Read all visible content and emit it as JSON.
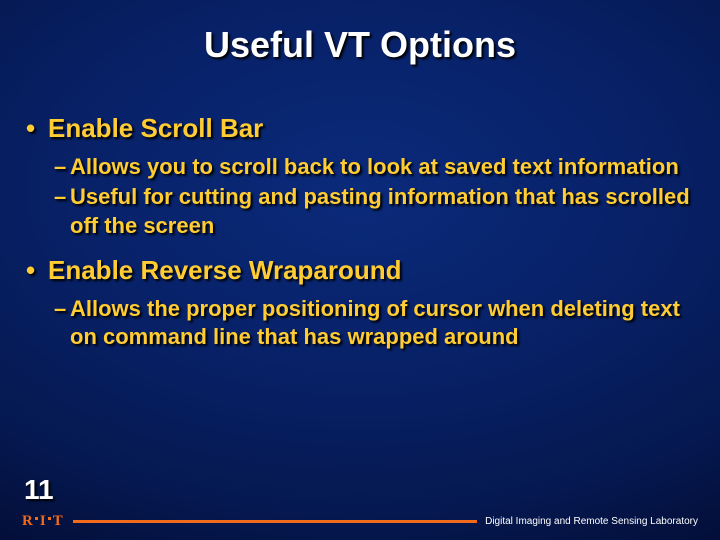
{
  "title": "Useful VT Options",
  "bullets": [
    {
      "text": "Enable Scroll Bar",
      "sub": [
        "Allows you to scroll back to look at saved text information",
        "Useful for cutting and pasting information that has scrolled off the screen"
      ]
    },
    {
      "text": "Enable Reverse Wraparound",
      "sub": [
        "Allows the proper positioning of cursor when deleting text on command line that has wrapped around"
      ]
    }
  ],
  "page_number": "11",
  "footer": {
    "logo_letters": [
      "R",
      "I",
      "T"
    ],
    "label": "Digital Imaging and Remote Sensing Laboratory"
  }
}
